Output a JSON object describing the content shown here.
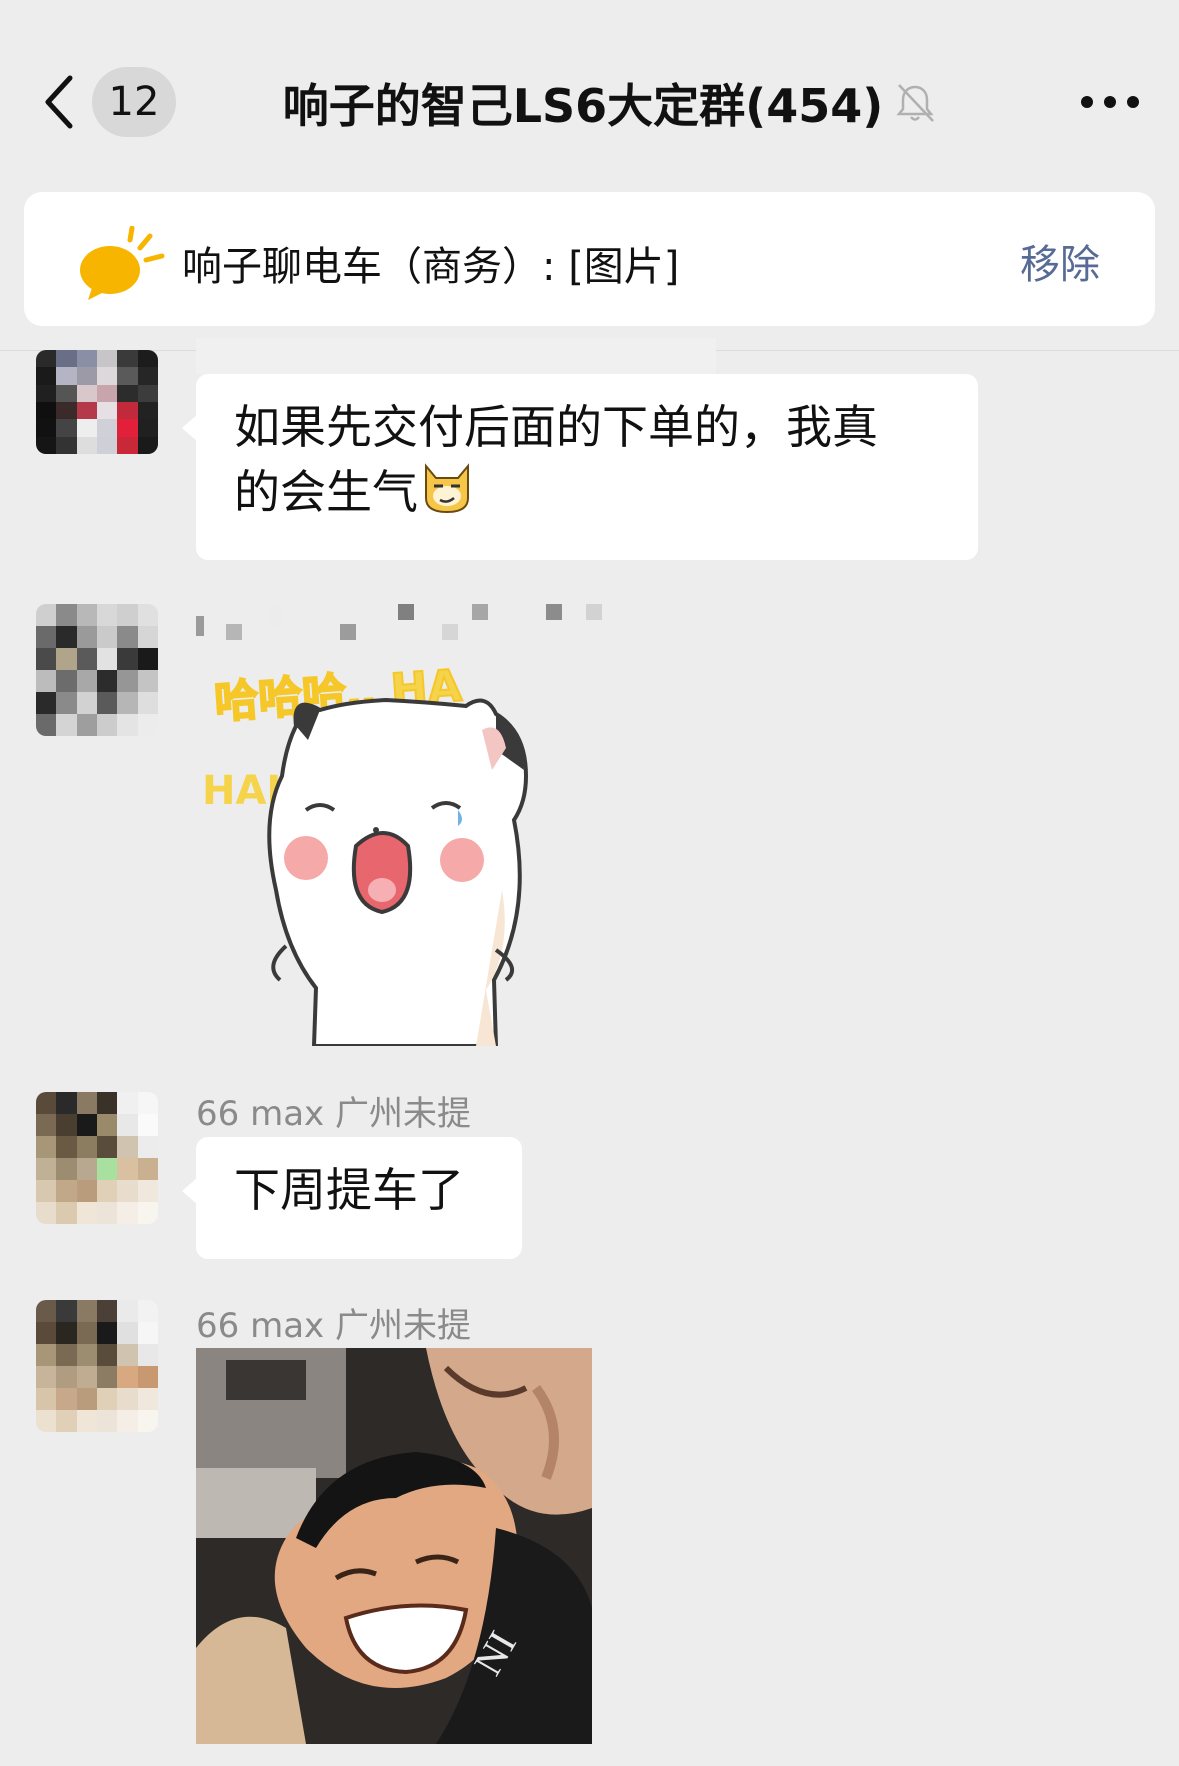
{
  "header": {
    "back_label": "Back",
    "unread_count": "12",
    "title": "响子的智己LS6大定群(454)",
    "mute_icon": "bell-muted-icon",
    "more_icon": "more-dots-icon"
  },
  "notice": {
    "icon": "announcement-horn-icon",
    "text": "响子聊电车（商务）: [图片]",
    "remove_label": "移除"
  },
  "messages": [
    {
      "sender": "",
      "type": "text",
      "lines": [
        "如果先交付后面的下单的，我真",
        "的会生气"
      ],
      "trailing_emoji": "cat-smirk-emoji"
    },
    {
      "sender": "",
      "type": "sticker",
      "sticker_icon": "laughing-cat-sticker",
      "sticker_text_top": "哈哈哈‥ HA",
      "sticker_text_side": "HAH"
    },
    {
      "sender": "66 max 广州未提",
      "type": "text",
      "lines": [
        "下周提车了"
      ]
    },
    {
      "sender": "66 max 广州未提",
      "type": "image",
      "image_icon": "laughing-people-photo"
    }
  ]
}
